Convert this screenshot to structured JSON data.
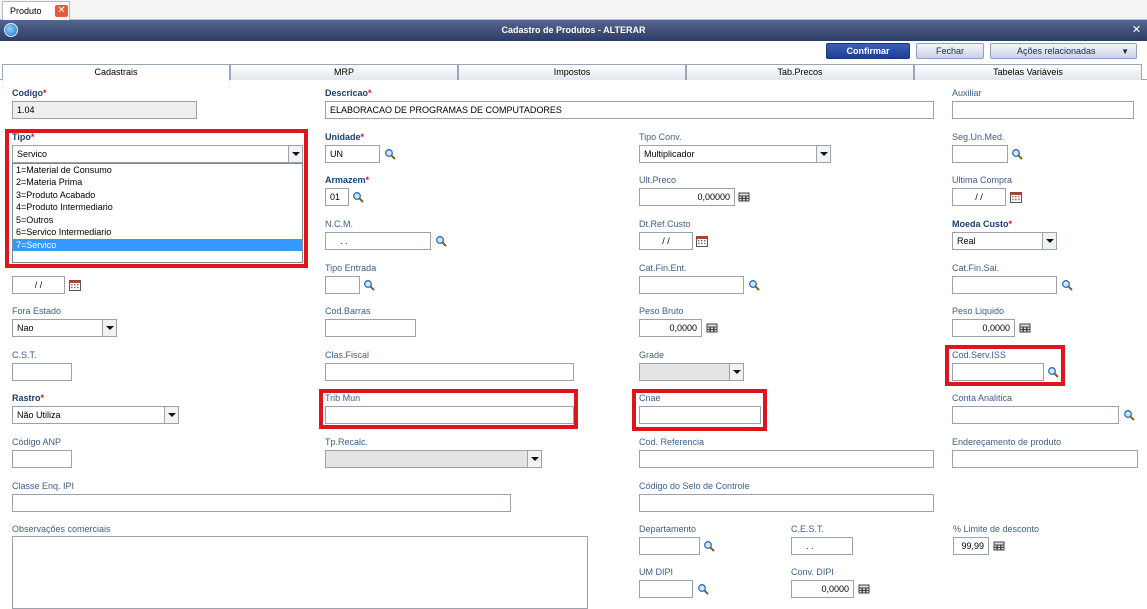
{
  "doc_tab": {
    "label": "Produto",
    "close": "✕"
  },
  "window": {
    "title": "Cadastro de Produtos - ALTERAR",
    "close": "✕"
  },
  "toolbar": {
    "confirm": "Confirmar",
    "close": "Fechar",
    "actions": "Ações relacionadas",
    "actions_caret": "▼"
  },
  "tabs": [
    "Cadastrais",
    "MRP",
    "Impostos",
    "Tab.Precos",
    "Tabelas Variáveis"
  ],
  "fields": {
    "codigo": {
      "label": "Codigo",
      "value": "1.04"
    },
    "descricao": {
      "label": "Descricao",
      "value": "ELABORACAO DE PROGRAMAS DE COMPUTADORES"
    },
    "auxiliar": {
      "label": "Auxiliar",
      "value": ""
    },
    "tipo": {
      "label": "Tipo",
      "value": "Servico"
    },
    "unidade": {
      "label": "Unidade",
      "value": "UN"
    },
    "tipo_conv": {
      "label": "Tipo Conv.",
      "value": "Multiplicador"
    },
    "seg_un_med": {
      "label": "Seg.Un.Med.",
      "value": ""
    },
    "armazem": {
      "label": "Armazem",
      "value": "01"
    },
    "ult_preco": {
      "label": "Ult.Preco",
      "value": "0,00000"
    },
    "ultima_compra": {
      "label": "Ultima Compra",
      "value": "/ /"
    },
    "ncm": {
      "label": "N.C.M.",
      "value": ". ."
    },
    "dt_ref_custo": {
      "label": "Dt.Ref.Custo",
      "value": "/ /"
    },
    "moeda_custo": {
      "label": "Moeda Custo",
      "value": "Real"
    },
    "ult_calc_custo": {
      "value": "/ /"
    },
    "tipo_entrada": {
      "label": "Tipo Entrada",
      "value": ""
    },
    "cat_fin_ent": {
      "label": "Cat.Fin.Ent.",
      "value": ""
    },
    "cat_fin_sai": {
      "label": "Cat.Fin.Sai.",
      "value": ""
    },
    "fora_estado": {
      "label": "Fora Estado",
      "value": "Nao"
    },
    "cod_barras": {
      "label": "Cod.Barras",
      "value": ""
    },
    "peso_bruto": {
      "label": "Peso Bruto",
      "value": "0,0000"
    },
    "peso_liquido": {
      "label": "Peso Liquido",
      "value": "0,0000"
    },
    "cst": {
      "label": "C.S.T.",
      "value": ""
    },
    "clas_fiscal": {
      "label": "Clas.Fiscal",
      "value": ""
    },
    "grade": {
      "label": "Grade",
      "value": ""
    },
    "cod_serv_iss": {
      "label": "Cod.Serv.ISS",
      "value": ""
    },
    "rastro": {
      "label": "Rastro",
      "value": "Não Utiliza"
    },
    "trib_mun": {
      "label": "Trib Mun",
      "value": ""
    },
    "cnae": {
      "label": "Cnae",
      "value": ""
    },
    "conta_analitica": {
      "label": "Conta Analitica",
      "value": ""
    },
    "codigo_anp": {
      "label": "Código ANP",
      "value": ""
    },
    "tp_recalc": {
      "label": "Tp.Recalc.",
      "value": ""
    },
    "cod_referencia": {
      "label": "Cod. Referencia",
      "value": ""
    },
    "enderecamento": {
      "label": "Endereçamento de produto",
      "value": ""
    },
    "classe_enq_ipi": {
      "label": "Classe Enq. IPI",
      "value": ""
    },
    "codigo_selo": {
      "label": "Código do Selo de Controle",
      "value": ""
    },
    "obs_comerciais": {
      "label": "Observações comerciais",
      "value": ""
    },
    "departamento": {
      "label": "Departamento",
      "value": ""
    },
    "cest": {
      "label": "C.E.S.T.",
      "value": ". ."
    },
    "limite_desconto": {
      "label": "% Limite de desconto",
      "value": "99,99"
    },
    "um_dipi": {
      "label": "UM DIPI",
      "value": ""
    },
    "conv_dipi": {
      "label": "Conv. DIPI",
      "value": "0,0000"
    }
  },
  "required_mark": "*",
  "tipo_options": [
    "1=Material de Consumo",
    "2=Materia Prima",
    "3=Produto Acabado",
    "4=Produto Intermediario",
    "5=Outros",
    "6=Servico Intermediario",
    "7=Servico"
  ],
  "tipo_selected_index": 6,
  "colors": {
    "highlight": "#e0141c",
    "selection": "#3399ff",
    "title_bar": "#2d3c62"
  },
  "icons": [
    "lookup-icon",
    "calendar-icon",
    "calculator-icon"
  ]
}
